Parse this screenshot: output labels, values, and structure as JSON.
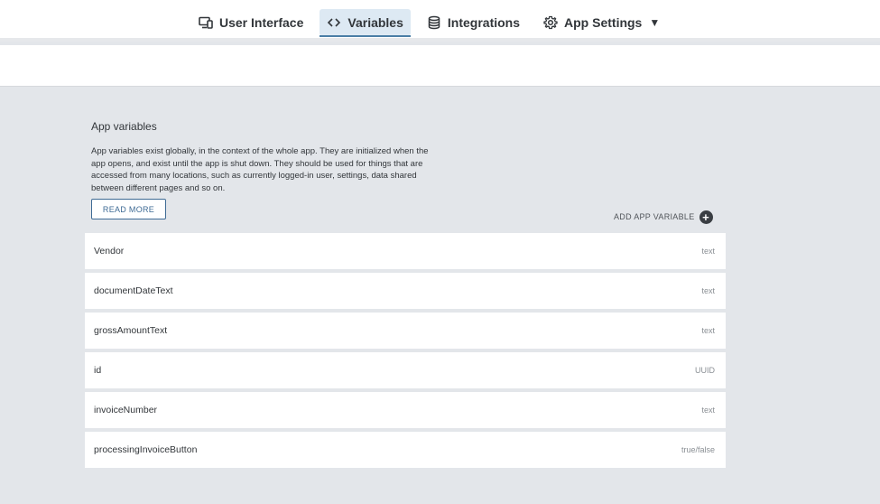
{
  "header": {
    "tabs": [
      {
        "label": "User Interface",
        "icon": "monitor-phone-icon",
        "active": false
      },
      {
        "label": "Variables",
        "icon": "code-brackets-icon",
        "active": true
      },
      {
        "label": "Integrations",
        "icon": "database-icon",
        "active": false
      },
      {
        "label": "App Settings",
        "icon": "gear-icon",
        "active": false,
        "caret": "▼"
      }
    ]
  },
  "section": {
    "title": "App variables",
    "description": "App variables exist globally, in the context of the whole app. They are initialized when the app opens, and exist until the app is shut down. They should be used for things that are accessed from many locations, such as currently logged-in user, settings, data shared between different pages and so on.",
    "read_more_label": "READ MORE",
    "add_label": "ADD APP VARIABLE",
    "add_icon": "plus-circle-icon"
  },
  "variables": [
    {
      "name": "Vendor",
      "type": "text"
    },
    {
      "name": "documentDateText",
      "type": "text"
    },
    {
      "name": "grossAmountText",
      "type": "text"
    },
    {
      "name": "id",
      "type": "UUID"
    },
    {
      "name": "invoiceNumber",
      "type": "text"
    },
    {
      "name": "processingInvoiceButton",
      "type": "true/false"
    }
  ],
  "colors": {
    "accent": "#3f6b95",
    "active_tab_bg": "#dde9f3",
    "page_bg": "#e3e6ea"
  }
}
